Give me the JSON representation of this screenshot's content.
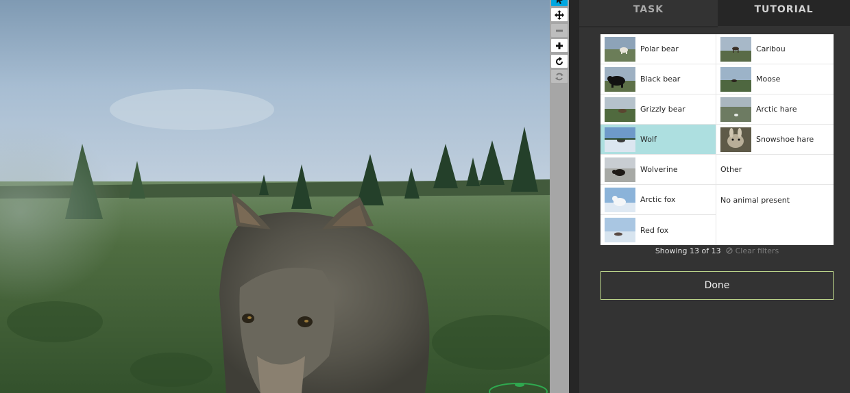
{
  "tabs": {
    "task": "TASK",
    "tutorial": "TUTORIAL"
  },
  "toolbar": {
    "tools": [
      {
        "name": "pointer-tool",
        "icon": "cursor-arrow-icon",
        "state": "active"
      },
      {
        "name": "pan-tool",
        "icon": "move-arrows-icon",
        "state": "normal"
      },
      {
        "name": "zoom-out-tool",
        "icon": "minus-icon",
        "state": "disabled"
      },
      {
        "name": "zoom-in-tool",
        "icon": "plus-icon",
        "state": "normal"
      },
      {
        "name": "rotate-tool",
        "icon": "rotate-icon",
        "state": "normal"
      },
      {
        "name": "reset-tool",
        "icon": "reset-icon",
        "state": "disabled"
      }
    ]
  },
  "choices": {
    "left": [
      {
        "label": "Polar bear",
        "selected": false
      },
      {
        "label": "Black bear",
        "selected": false
      },
      {
        "label": "Grizzly bear",
        "selected": false
      },
      {
        "label": "Wolf",
        "selected": true
      },
      {
        "label": "Wolverine",
        "selected": false
      },
      {
        "label": "Arctic fox",
        "selected": false
      },
      {
        "label": "Red fox",
        "selected": false
      }
    ],
    "right": [
      {
        "label": "Caribou",
        "selected": false
      },
      {
        "label": "Moose",
        "selected": false
      },
      {
        "label": "Arctic hare",
        "selected": false
      },
      {
        "label": "Snowshoe hare",
        "selected": false
      },
      {
        "label": "Other",
        "selected": false
      },
      {
        "label": "No animal present",
        "selected": false
      }
    ]
  },
  "footer": {
    "showing": "Showing 13 of 13",
    "clear": "Clear filters"
  },
  "done_label": "Done",
  "colors": {
    "selected_bg": "#addfe0",
    "active_tool": "#00a7e0",
    "done_border": "#bcd58a"
  }
}
